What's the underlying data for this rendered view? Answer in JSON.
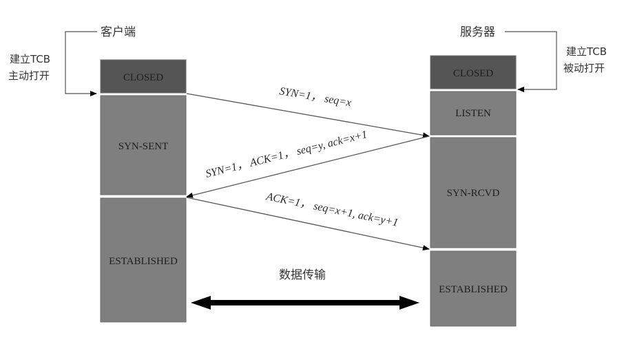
{
  "client": {
    "title": "客户端",
    "open_note": [
      "建立TCB",
      "主动打开"
    ],
    "states": [
      {
        "label": "CLOSED",
        "color": "#555555"
      },
      {
        "label": "SYN-SENT",
        "color": "#7f7f7f"
      },
      {
        "label": "ESTABLISHED",
        "color": "#7f7f7f"
      }
    ]
  },
  "server": {
    "title": "服务器",
    "open_note": [
      "建立TCB",
      "被动打开"
    ],
    "states": [
      {
        "label": "CLOSED",
        "color": "#555555"
      },
      {
        "label": "LISTEN",
        "color": "#7f7f7f"
      },
      {
        "label": "SYN-RCVD",
        "color": "#7f7f7f"
      },
      {
        "label": "ESTABLISHED",
        "color": "#7f7f7f"
      }
    ]
  },
  "messages": [
    {
      "label": "SYN=1， seq=x",
      "direction": "client-to-server"
    },
    {
      "label": "SYN=1， ACK=1， seq=y, ack=x+1",
      "direction": "server-to-client"
    },
    {
      "label": "ACK=1， seq=x+1, ack=y+1",
      "direction": "client-to-server"
    }
  ],
  "data_transfer": {
    "label": "数据传输",
    "direction": "bidirectional"
  }
}
